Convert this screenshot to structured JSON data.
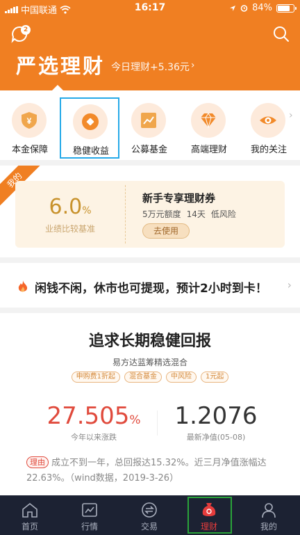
{
  "status_bar": {
    "carrier": "中国联通",
    "time": "16:17",
    "battery": "84%",
    "battery_level": 0.84
  },
  "header": {
    "message_badge": "2",
    "title": "严选理财",
    "today_label": "今日理财+5.36元",
    "today_arrow": "›"
  },
  "category_nav": [
    {
      "label": "本金保障",
      "icon": "shield-yuan-icon"
    },
    {
      "label": "稳健收益",
      "icon": "coin-icon"
    },
    {
      "label": "公募基金",
      "icon": "chart-icon"
    },
    {
      "label": "高端理财",
      "icon": "diamond-icon"
    },
    {
      "label": "我的关注",
      "icon": "eye-icon"
    }
  ],
  "category_active_index": 1,
  "coupon": {
    "ribbon": "我的",
    "rate_value": "6.0",
    "rate_unit": "%",
    "rate_label": "业绩比较基准",
    "title": "新手专享理财券",
    "amount": "5万元额度",
    "term": "14天",
    "risk": "低风险",
    "action": "去使用"
  },
  "notice": {
    "text": "闲钱不闲，休市也可提现，预计2小时到卡！",
    "arrow": "›"
  },
  "product": {
    "headline": "追求长期稳健回报",
    "fund_name": "易方达蓝筹精选混合",
    "tags": [
      "申购费1折起",
      "混合基金",
      "中风险",
      "1元起"
    ],
    "return_value": "27.505",
    "return_unit": "%",
    "return_label": "今年以来涨跌",
    "nav_value": "1.2076",
    "nav_label": "最新净值(05-08)",
    "reason_tag": "理由",
    "reason_text": "成立不到一年，总回报达15.32%。近三月净值涨幅达22.63%。（wind数据，2019-3-26）"
  },
  "tab_bar": [
    {
      "label": "首页",
      "icon": "home-icon"
    },
    {
      "label": "行情",
      "icon": "market-chart-icon"
    },
    {
      "label": "交易",
      "icon": "exchange-icon"
    },
    {
      "label": "理财",
      "icon": "wealth-bag-icon"
    },
    {
      "label": "我的",
      "icon": "person-icon"
    }
  ],
  "tab_active_index": 3,
  "colors": {
    "brand_orange": "#f07f22",
    "return_red": "#e04a3c",
    "tabbar_bg": "#1c2233",
    "active_nav_outline": "#25a9e8",
    "active_tab_outline": "#2aa43a"
  }
}
